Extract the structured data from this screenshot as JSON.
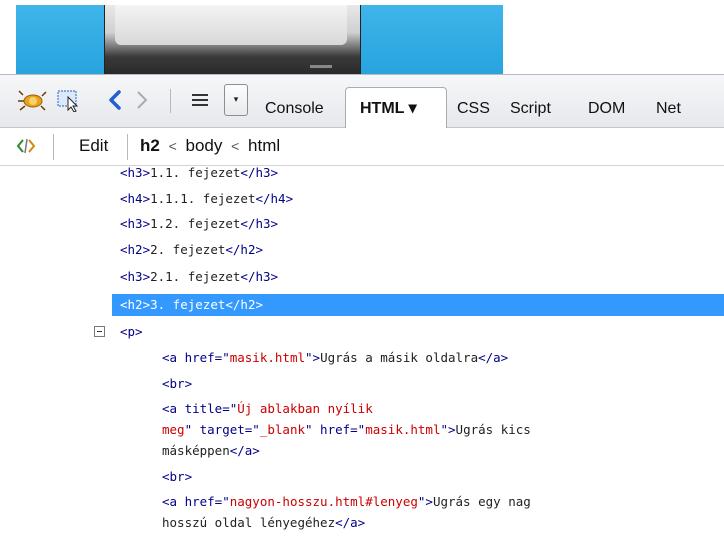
{
  "toolbar": {
    "tabs": {
      "console": "Console",
      "html": "HTML ▾",
      "css": "CSS",
      "script": "Script",
      "dom": "DOM",
      "net": "Net"
    },
    "icons": [
      "firebug-icon",
      "inspect-icon",
      "back-arrow-icon",
      "forward-arrow-icon",
      "menu-icon",
      "dropdown-arrow-icon"
    ]
  },
  "breadcrumb": {
    "edit": "Edit",
    "current": "h2",
    "sep1": "<",
    "parent1": "body",
    "sep2": "<",
    "parent2": "html"
  },
  "tree": {
    "l1_open": "<h3>",
    "l1_text": "1.1. fejezet",
    "l1_close": "</h3>",
    "l2_open": "<h4>",
    "l2_text": "1.1.1. fejezet",
    "l2_close": "</h4>",
    "l3_open": "<h3>",
    "l3_text": "1.2. fejezet",
    "l3_close": "</h3>",
    "l4_open": "<h2>",
    "l4_text": "2. fejezet",
    "l4_close": "</h2>",
    "l5_open": "<h3>",
    "l5_text": "2.1. fejezet",
    "l5_close": "</h3>",
    "l6_open": "<h2>",
    "l6_text": "3. fejezet",
    "l6_close": "</h2>",
    "p_open": "<p>",
    "a1_pre": "<a href=\"",
    "a1_href": "masik.html",
    "a1_mid": "\">",
    "a1_text": "Ugrás a másik oldalra",
    "a1_close": "</a>",
    "br1": "<br>",
    "a2_pre": "<a title=\"",
    "a2_title1": "Új ablakban nyílik",
    "a2_title2": "meg",
    "a2_t2": "\" target=\"",
    "a2_target": "_blank",
    "a2_t3": "\" href=\"",
    "a2_href": "masik.html",
    "a2_t4": "\">",
    "a2_text1": "Ugrás kics",
    "a2_text2": "másképpen",
    "a2_close": "</a>",
    "br2": "<br>",
    "a3_pre": "<a href=\"",
    "a3_href": "nagyon-hosszu.html#lenyeg",
    "a3_mid": "\">",
    "a3_text1": "Ugrás egy nag",
    "a3_text2": "hosszú oldal lényegéhez",
    "a3_close": "</a>"
  },
  "colors": {
    "selection": "#3399ff",
    "tag": "#000088",
    "attr_value": "#cc0000",
    "banner": "#2fa8e2"
  }
}
